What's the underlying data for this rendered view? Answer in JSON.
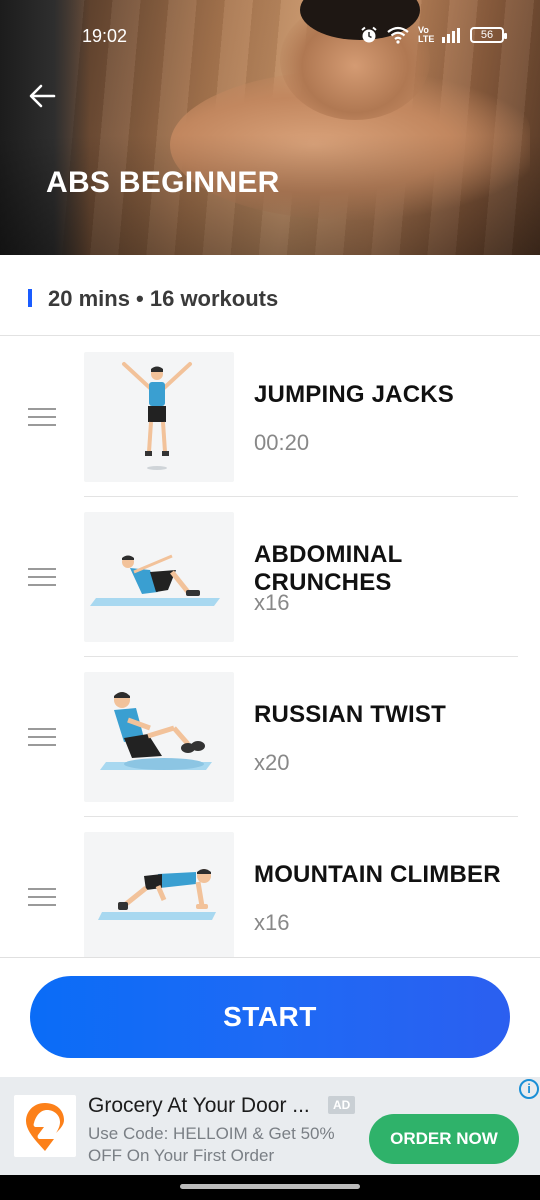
{
  "status_bar": {
    "time": "19:02",
    "alarm_icon": "alarm-icon",
    "wifi_icon": "wifi-icon",
    "volte": "Vo LTE",
    "signal_icon": "signal-icon",
    "battery": "56"
  },
  "header": {
    "back_icon": "back-arrow-icon",
    "title": "ABS BEGINNER"
  },
  "summary": {
    "text": "20 mins • 16 workouts",
    "accent_color": "#1a5cff"
  },
  "workouts": [
    {
      "name": "JUMPING JACKS",
      "amount": "00:20",
      "image": "jumping-jacks-illustration"
    },
    {
      "name": "ABDOMINAL CRUNCHES",
      "amount": "x16",
      "image": "abdominal-crunches-illustration"
    },
    {
      "name": "RUSSIAN TWIST",
      "amount": "x20",
      "image": "russian-twist-illustration"
    },
    {
      "name": "MOUNTAIN CLIMBER",
      "amount": "x16",
      "image": "mountain-climber-illustration"
    }
  ],
  "actions": {
    "start_label": "START",
    "start_color": "#1e6af5"
  },
  "ad": {
    "title": "Grocery At Your Door ...",
    "badge": "AD",
    "subtitle": "Use Code: HELLOIM & Get 50% OFF On Your First Order",
    "button": "ORDER NOW",
    "button_color": "#2fb26a",
    "logo_icon": "swiggy-logo-icon",
    "info_icon": "i"
  }
}
